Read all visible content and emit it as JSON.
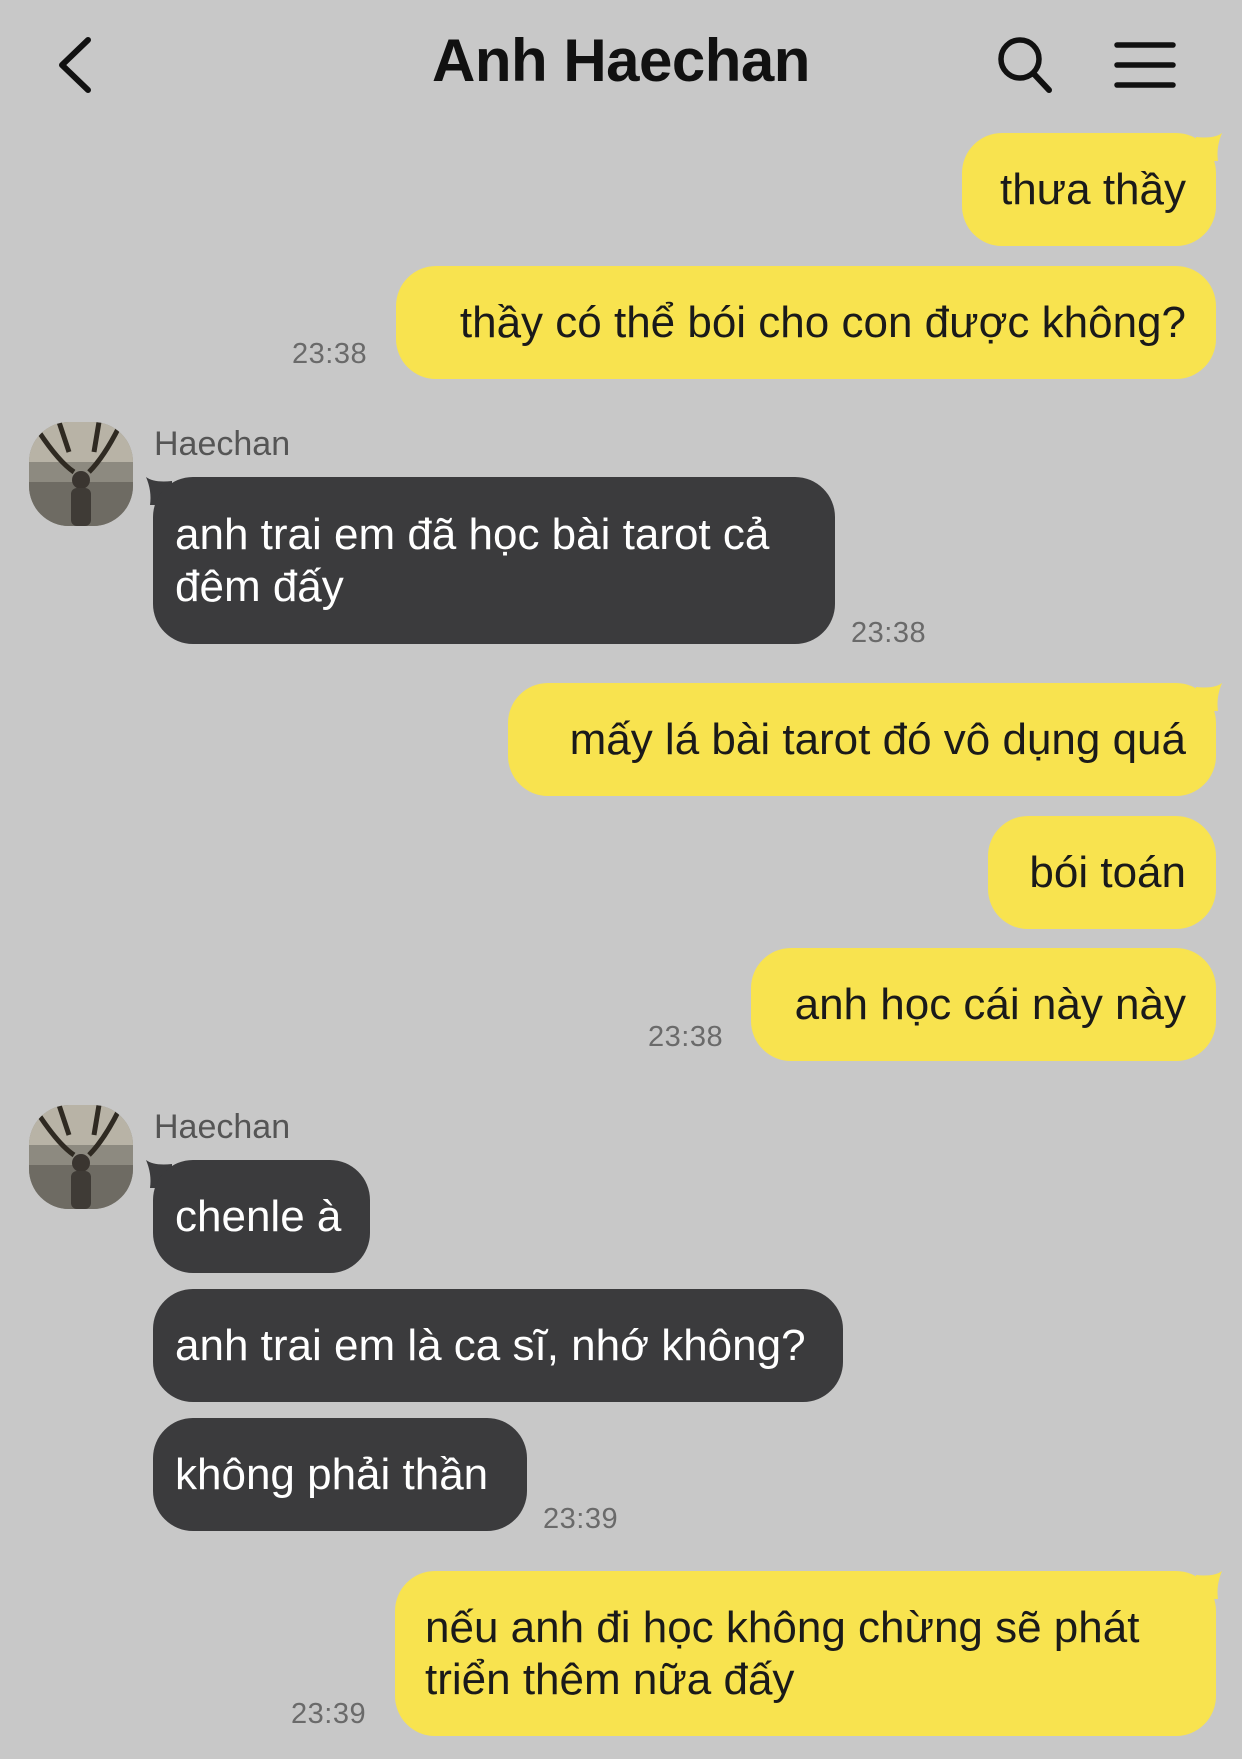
{
  "header": {
    "title": "Anh Haechan",
    "back_icon": "chevron-left-icon",
    "search_icon": "search-icon",
    "menu_icon": "hamburger-menu-icon"
  },
  "colors": {
    "background": "#c8c8c8",
    "my_bubble": "#f8e34f",
    "their_bubble": "#3b3b3d"
  },
  "messages": [
    {
      "from": "me",
      "text": "thưa thầy"
    },
    {
      "from": "me",
      "text": "thầy có thể bói cho con được không?",
      "time": "23:38"
    },
    {
      "from": "them",
      "sender": "Haechan",
      "text": "anh trai em đã học bài tarot cả đêm đấy",
      "time": "23:38"
    },
    {
      "from": "me",
      "text": "mấy lá bài tarot đó vô dụng quá"
    },
    {
      "from": "me",
      "text": "bói toán"
    },
    {
      "from": "me",
      "text": "anh học cái này này",
      "time": "23:38"
    },
    {
      "from": "them",
      "sender": "Haechan",
      "text": "chenle à"
    },
    {
      "from": "them",
      "text": "anh trai em là ca sĩ, nhớ không?"
    },
    {
      "from": "them",
      "text": "không phải thần",
      "time": "23:39"
    },
    {
      "from": "me",
      "text": "nếu anh đi học không chừng sẽ phát triển thêm nữa đấy",
      "time": "23:39"
    }
  ]
}
